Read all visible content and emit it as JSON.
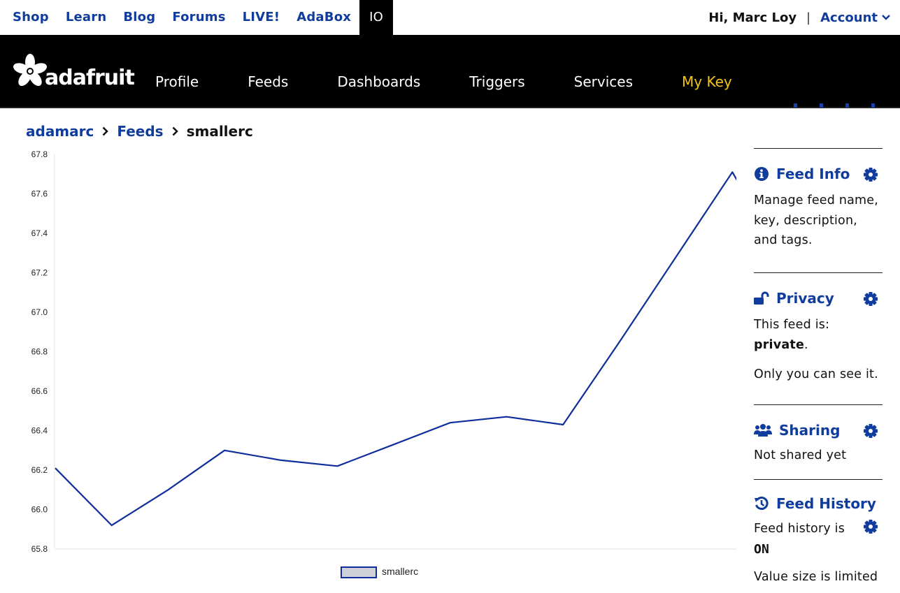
{
  "topbar": {
    "links": [
      "Shop",
      "Learn",
      "Blog",
      "Forums",
      "LIVE!",
      "AdaBox",
      "IO"
    ],
    "active": "IO",
    "greeting": "Hi, Marc Loy",
    "separator": "|",
    "account_label": "Account"
  },
  "nav": {
    "logo_text": "adafruit",
    "items": [
      "Profile",
      "Feeds",
      "Dashboards",
      "Triggers",
      "Services",
      "My Key"
    ]
  },
  "colors": {
    "brand_blue": "#103c9e",
    "nav_bg": "#000000",
    "mykey": "#f5c518",
    "series": "#0f2d9b"
  },
  "breadcrumb": {
    "user": "adamarc",
    "section": "Feeds",
    "current": "smallerc"
  },
  "chart_data": {
    "type": "line",
    "title": "",
    "xlabel": "",
    "ylabel": "",
    "ylim": [
      65.8,
      67.8
    ],
    "yticks": [
      "67.8",
      "67.6",
      "67.4",
      "67.2",
      "67.0",
      "66.8",
      "66.6",
      "66.4",
      "66.2",
      "66.0",
      "65.8"
    ],
    "series": [
      {
        "name": "smallerc",
        "values": [
          66.21,
          65.92,
          66.1,
          66.3,
          66.25,
          66.22,
          66.33,
          66.44,
          66.47,
          66.43,
          66.85,
          67.28,
          67.71,
          67.21
        ]
      }
    ],
    "grid": false,
    "legend": "bottom-center"
  },
  "sidebar": {
    "feed_info": {
      "title": "Feed Info",
      "desc": "Manage feed name, key, description, and tags."
    },
    "privacy": {
      "title": "Privacy",
      "line1": "This feed is:",
      "status": "private",
      "period": ".",
      "line2": "Only you can see it."
    },
    "sharing": {
      "title": "Sharing",
      "desc": "Not shared yet"
    },
    "history": {
      "title": "Feed History",
      "line1": "Feed history is",
      "status": "ON",
      "line2": "Value size is limited"
    }
  }
}
